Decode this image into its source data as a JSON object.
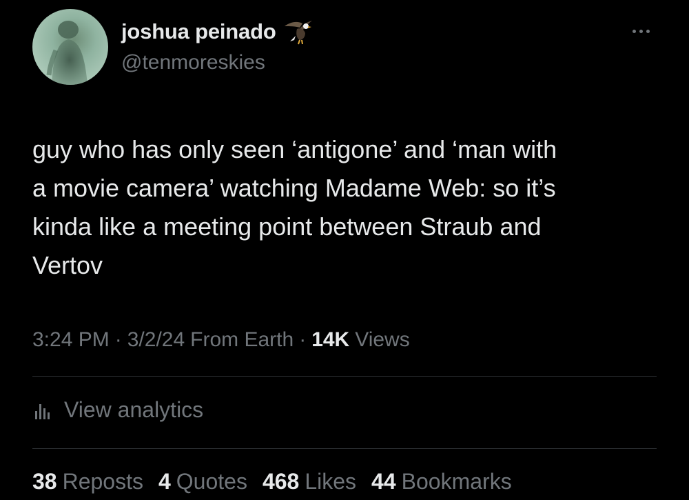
{
  "author": {
    "display_name": "joshua peinado",
    "badge_icon": "eagle-icon",
    "handle": "@tenmoreskies",
    "avatar": "avatar-image"
  },
  "more_icon": "more-horizontal-icon",
  "tweet": {
    "text": "guy who has only seen ‘antigone’ and ‘man with\na movie camera’ watching Madame Web: so it’s\nkinda like a meeting point between Straub and\nVertov"
  },
  "meta": {
    "time": "3:24 PM",
    "separator": "·",
    "date": "3/2/24",
    "source": "From Earth",
    "views_count": "14K",
    "views_label": "Views"
  },
  "analytics": {
    "icon": "bar-chart-icon",
    "label": "View analytics"
  },
  "stats": {
    "reposts_count": "38",
    "reposts_label": "Reposts",
    "quotes_count": "4",
    "quotes_label": "Quotes",
    "likes_count": "468",
    "likes_label": "Likes",
    "bookmarks_count": "44",
    "bookmarks_label": "Bookmarks"
  },
  "colors": {
    "background": "#000000",
    "primary_text": "#e7e9ea",
    "secondary_text": "#71767b",
    "divider": "#2f3336"
  }
}
